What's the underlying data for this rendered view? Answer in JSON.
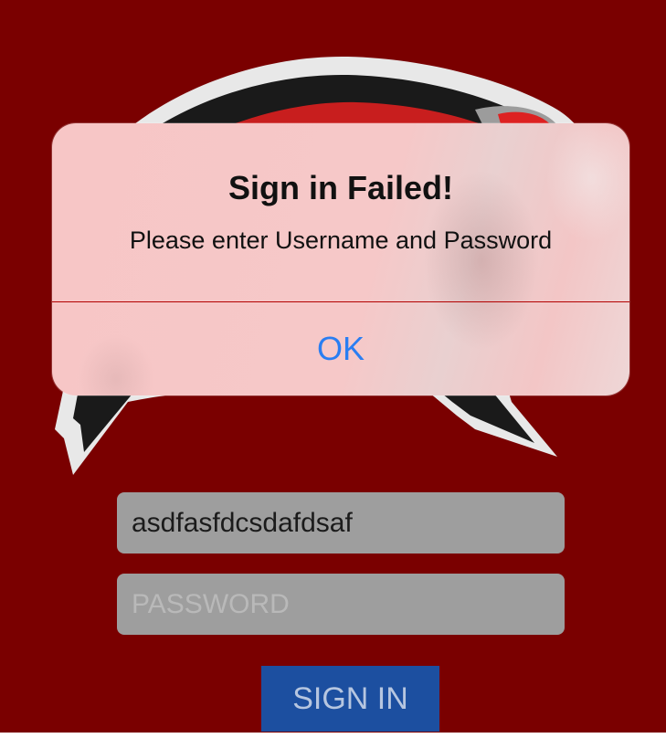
{
  "login": {
    "username_value": "asdfasfdcsdafdsaf",
    "password_placeholder": "PASSWORD",
    "sign_in_label": "SIGN IN"
  },
  "alert": {
    "title": "Sign in Failed!",
    "message": "Please enter Username and Password",
    "ok_label": "OK"
  },
  "colors": {
    "background": "#7a0000",
    "field_background": "#9e9e9e",
    "sign_in_button": "#1c4fa0",
    "alert_button_text": "#2a7ef2"
  },
  "icons": {
    "logo": "mascot-logo"
  }
}
